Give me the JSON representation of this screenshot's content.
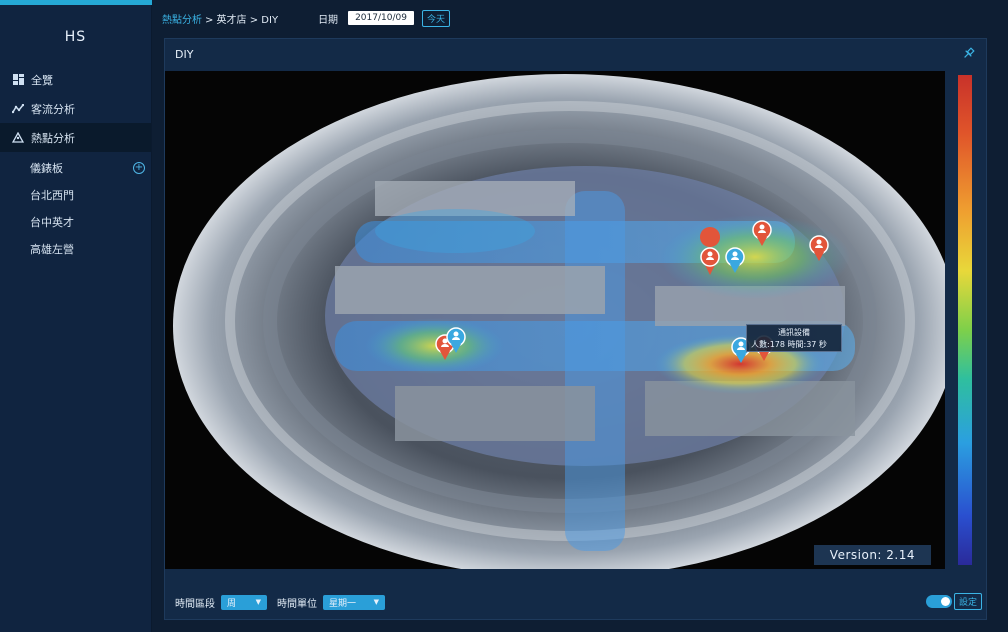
{
  "brand": "HS",
  "nav": [
    {
      "label": "全覽",
      "icon": "dashboard-icon"
    },
    {
      "label": "客流分析",
      "icon": "trend-line-icon"
    },
    {
      "label": "熱點分析",
      "icon": "mountain-icon"
    }
  ],
  "sub_nav": [
    {
      "label": "儀錶板"
    },
    {
      "label": "台北西門"
    },
    {
      "label": "台中英才"
    },
    {
      "label": "高雄左營"
    }
  ],
  "breadcrumb": {
    "root": "熱點分析",
    "rest": "> 英才店 > DIY"
  },
  "date": {
    "label": "日期",
    "value": "2017/10/09",
    "today_label": "今天"
  },
  "panel": {
    "title": "DIY"
  },
  "tooltip": {
    "title": "通訊設備",
    "detail": "人數:178  時間:37 秒"
  },
  "version": "Version: 2.14",
  "footer": {
    "period_label": "時間區段",
    "period_value": "周",
    "unit_label": "時間單位",
    "unit_value": "星期一"
  },
  "settings_label": "設定",
  "colors": {
    "accent": "#2a9fd8",
    "sidebar": "#102440",
    "panel": "#132a47"
  }
}
